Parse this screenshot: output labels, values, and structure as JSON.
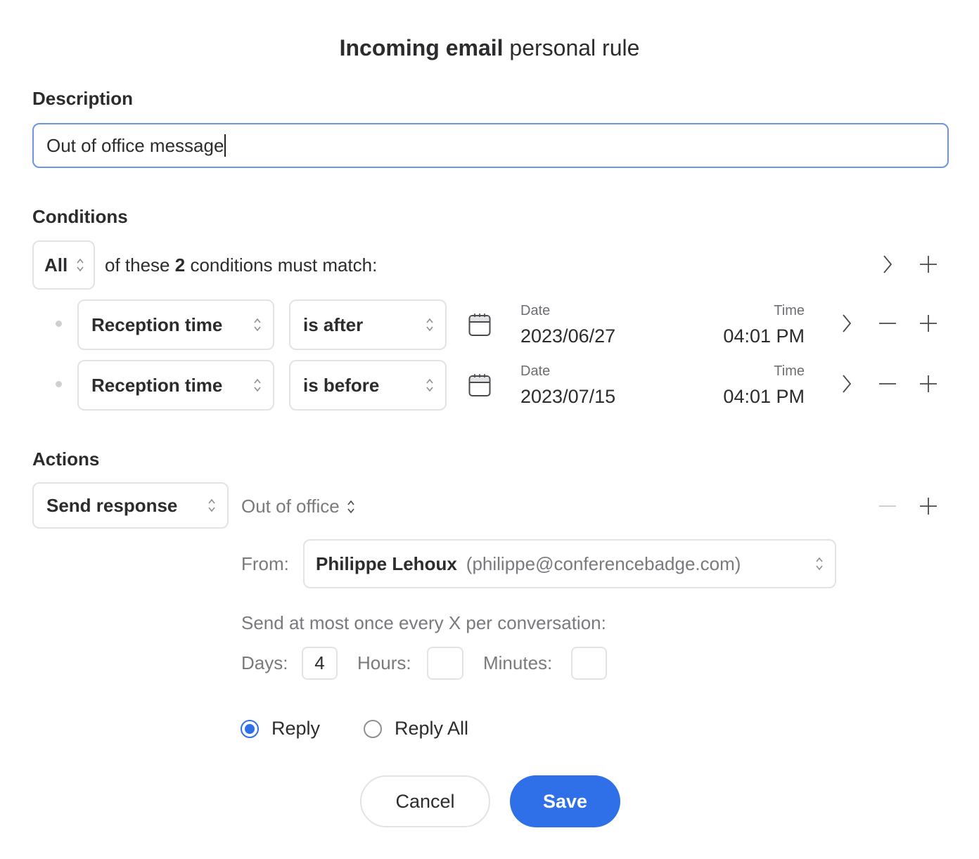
{
  "dialog": {
    "title_bold": "Incoming email",
    "title_rest": " personal rule"
  },
  "description": {
    "label": "Description",
    "value": "Out of office message"
  },
  "conditions": {
    "label": "Conditions",
    "match_mode": "All",
    "match_prefix": "of these",
    "count": "2",
    "match_suffix": "conditions must match:",
    "rows": [
      {
        "field": "Reception time",
        "operator": "is after",
        "date_label": "Date",
        "date": "2023/06/27",
        "time_label": "Time",
        "time": "04:01 PM"
      },
      {
        "field": "Reception time",
        "operator": "is before",
        "date_label": "Date",
        "date": "2023/07/15",
        "time_label": "Time",
        "time": "04:01 PM"
      }
    ]
  },
  "actions": {
    "label": "Actions",
    "action": "Send response",
    "template": "Out of office",
    "from_label": "From:",
    "from_name": "Philippe Lehoux",
    "from_email": "(philippe@conferencebadge.com)",
    "throttle_label": "Send at most once every X per conversation:",
    "days_label": "Days:",
    "days_value": "4",
    "hours_label": "Hours:",
    "hours_value": "",
    "minutes_label": "Minutes:",
    "minutes_value": "",
    "reply_options": [
      {
        "label": "Reply",
        "selected": true
      },
      {
        "label": "Reply All",
        "selected": false
      }
    ]
  },
  "buttons": {
    "cancel": "Cancel",
    "save": "Save"
  },
  "colors": {
    "accent": "#2f6fe8",
    "focus_border": "#6b93e6"
  }
}
